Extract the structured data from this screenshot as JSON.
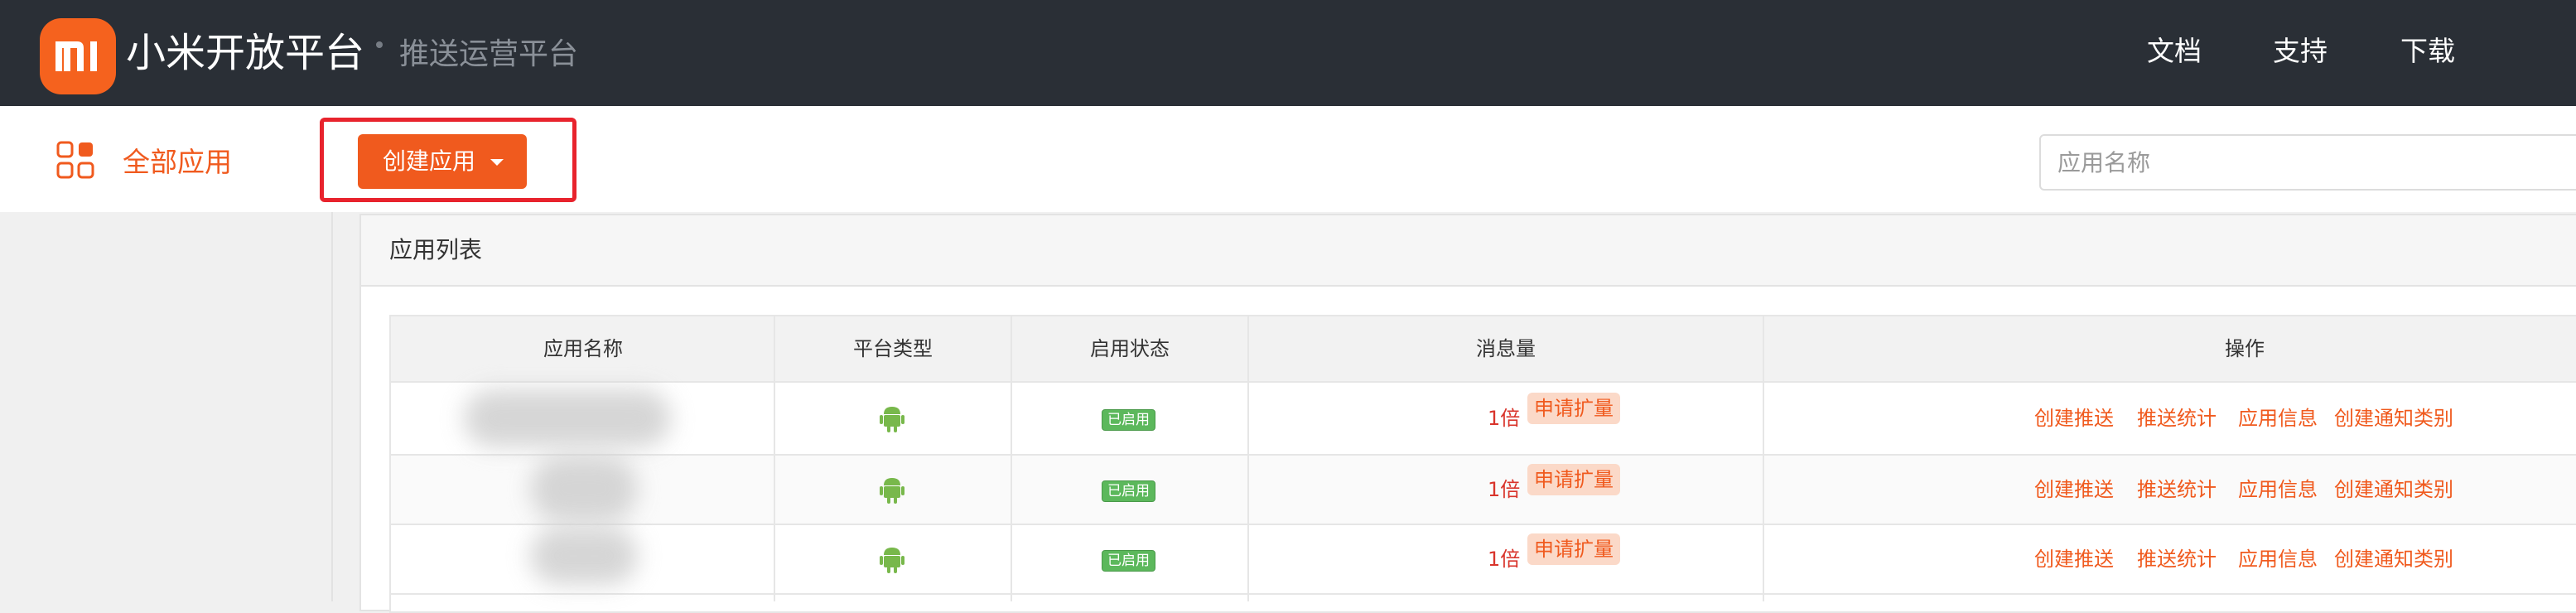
{
  "colors": {
    "topbar_bg": "#2a2f36",
    "brand_orange": "#f05a1e",
    "highlight_red": "#e8232d",
    "status_green": "#5cb85c",
    "link_red": "#d9342b",
    "expand_bg": "#fbd9c8"
  },
  "header": {
    "logo_text": "mi",
    "brand": "小米开放平台",
    "subtitle": "推送运营平台",
    "nav": [
      "文档",
      "支持",
      "下载"
    ]
  },
  "toolbar": {
    "all_apps_label": "全部应用",
    "apps_icon": "grid-icon",
    "create_app_label": "创建应用",
    "create_app_icon": "caret-down-icon",
    "search_placeholder": "应用名称"
  },
  "panel": {
    "title": "应用列表"
  },
  "table": {
    "columns": [
      "应用名称",
      "平台类型",
      "启用状态",
      "消息量",
      "操作"
    ],
    "rows": [
      {
        "name": "",
        "platform_icon": "android-icon",
        "status": "已启用",
        "multiplier": "1倍",
        "expand": "申请扩量",
        "actions": [
          "创建推送",
          "推送统计",
          "应用信息",
          "创建通知类别"
        ]
      },
      {
        "name": "",
        "platform_icon": "android-icon",
        "status": "已启用",
        "multiplier": "1倍",
        "expand": "申请扩量",
        "actions": [
          "创建推送",
          "推送统计",
          "应用信息",
          "创建通知类别"
        ]
      },
      {
        "name": "",
        "platform_icon": "android-icon",
        "status": "已启用",
        "multiplier": "1倍",
        "expand": "申请扩量",
        "actions": [
          "创建推送",
          "推送统计",
          "应用信息",
          "创建通知类别"
        ]
      }
    ]
  }
}
